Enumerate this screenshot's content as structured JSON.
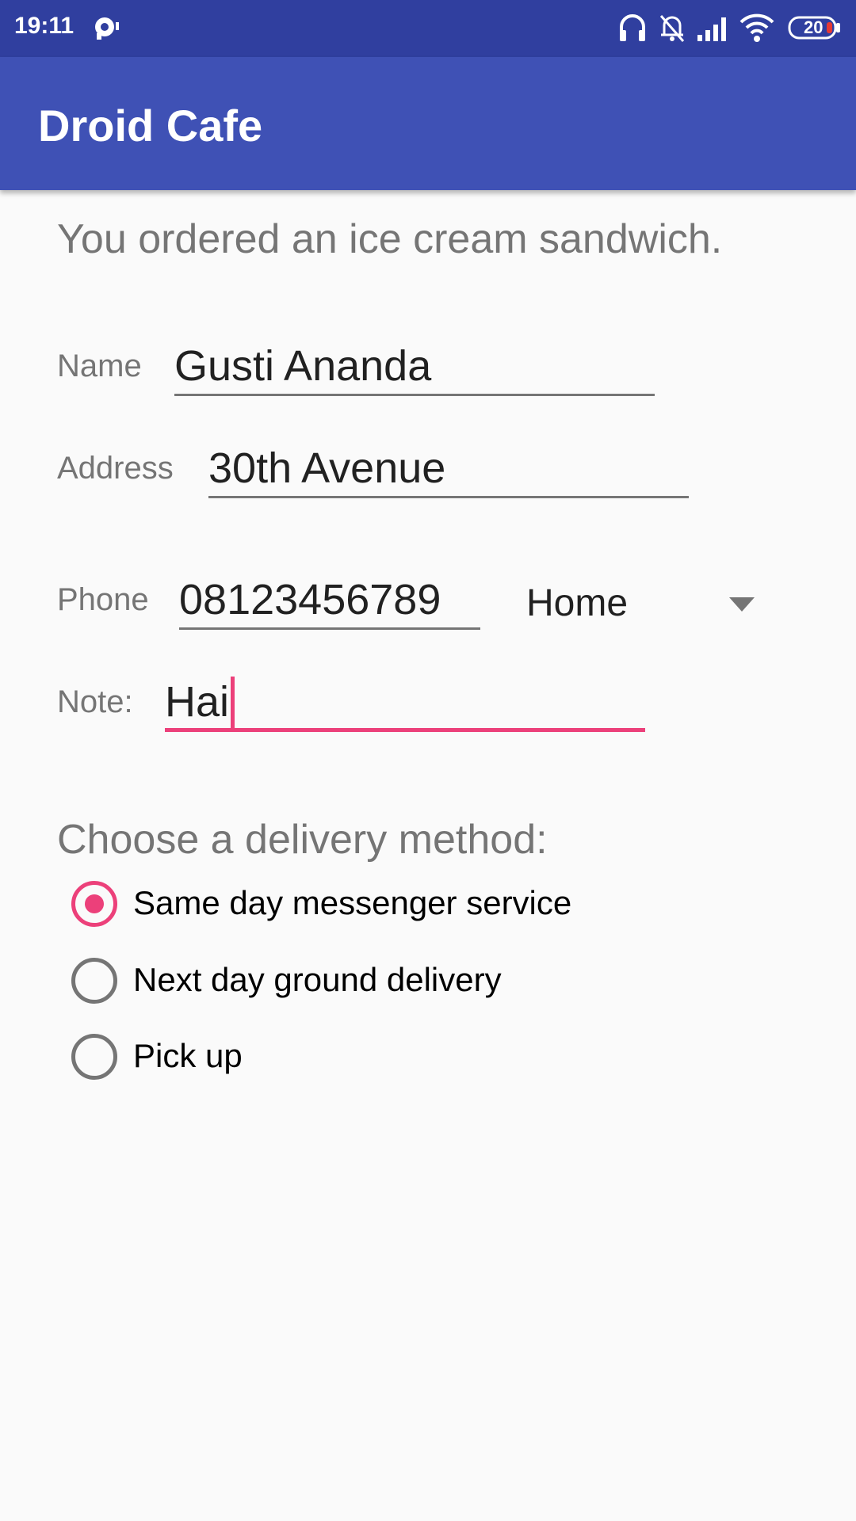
{
  "status_bar": {
    "time": "19:11",
    "battery": "20",
    "icons": [
      "notification-icon",
      "headphones-icon",
      "bell-off-icon",
      "signal-icon",
      "wifi-icon",
      "battery-icon"
    ]
  },
  "app_bar": {
    "title": "Droid Cafe"
  },
  "order": {
    "message": "You ordered an ice cream sandwich."
  },
  "form": {
    "name": {
      "label": "Name",
      "value": "Gusti Ananda"
    },
    "address": {
      "label": "Address",
      "value": "30th Avenue"
    },
    "phone": {
      "label": "Phone",
      "value": "08123456789",
      "type_selected": "Home"
    },
    "note": {
      "label": "Note:",
      "value": "Hai"
    }
  },
  "delivery": {
    "heading": "Choose a delivery method:",
    "options": [
      {
        "label": "Same day messenger service",
        "checked": true
      },
      {
        "label": "Next day ground delivery",
        "checked": false
      },
      {
        "label": "Pick up",
        "checked": false
      }
    ]
  },
  "colors": {
    "status_bar": "#303f9f",
    "app_bar": "#3f51b5",
    "accent": "#ec407a",
    "background": "#fafafa"
  }
}
